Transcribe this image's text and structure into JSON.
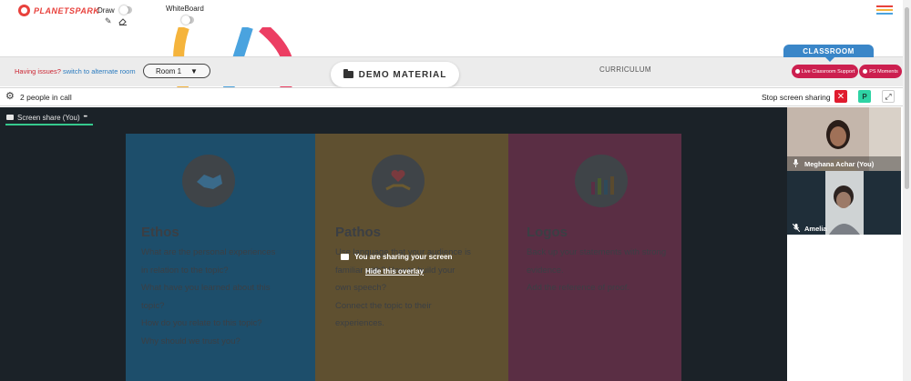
{
  "app": {
    "logo_text": "PLANETSPARK",
    "brand_color": "#e8413c"
  },
  "toolbar": {
    "draw_label": "Draw",
    "whiteboard_label": "WhiteBoard"
  },
  "room_bar": {
    "issue_text": "Having issues?",
    "alt_room_link": "switch to alternate room",
    "room_select_value": "Room 1",
    "demo_material_label": "DEMO MATERIAL",
    "curriculum_label": "CURRICULUM",
    "classroom_tab_label": "CLASSROOM",
    "live_support_label": "Live Classroom Support",
    "ps_moments_label": "PS Moments"
  },
  "call_bar": {
    "people_count_text": "2 people in call",
    "stop_sharing_label": "Stop screen sharing",
    "stop_button_glyph": "✕",
    "p_button_label": "P"
  },
  "screen_share": {
    "tab_label": "Screen share (You)",
    "more_glyph": "•••",
    "overlay_message": "You are sharing your screen",
    "hide_overlay_link": "Hide this overlay"
  },
  "slide": {
    "columns": [
      {
        "title": "Ethos",
        "color": "#2a8dc5",
        "lines": [
          "What are the personal experiences",
          "in relation to the topic?",
          "What have you learned about this",
          "topic?",
          "How do you relate to this topic?",
          "Why should we trust you?"
        ]
      },
      {
        "title": "Pathos",
        "color": "#e6b129",
        "lines": [
          "Use language that your audience is",
          "familiar with? How to build your",
          "own speech?",
          "Connect the topic to their",
          "experiences."
        ]
      },
      {
        "title": "Logos",
        "color": "#e0417a",
        "lines": [
          "Back up your statements with strong",
          "evidence.",
          "Add the reference of proof."
        ]
      }
    ]
  },
  "participants": [
    {
      "name": "Meghana Achar (You)",
      "mic": "mic-icon"
    },
    {
      "name": "Amelia",
      "mic": "mic-muted-icon"
    }
  ]
}
